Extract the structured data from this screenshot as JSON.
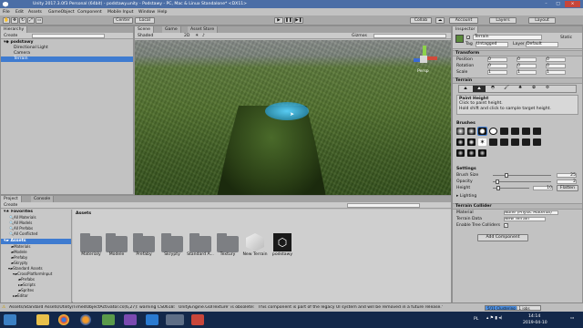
{
  "window": {
    "title": "Unity 2017.3.0f3 Personal (64bit) - podstawy.unity - Podstawy - PC, Mac & Linux Standalone* <DX11>"
  },
  "menu": [
    "File",
    "Edit",
    "Assets",
    "GameObject",
    "Component",
    "Mobile Input",
    "Window",
    "Help"
  ],
  "toolbar": {
    "center_label": "Center",
    "local_label": "Local",
    "collab_label": "Collab",
    "account_label": "Account",
    "layers_label": "Layers",
    "layout_label": "Layout"
  },
  "hierarchy": {
    "tab": "Hierarchy",
    "create_label": "Create",
    "search_placeholder": "All",
    "scene_name": "podstawy",
    "items": [
      "Directional Light",
      "Camera",
      "Terrain"
    ]
  },
  "scene_view": {
    "tabs": [
      "Scene",
      "Game",
      "Asset Store"
    ],
    "shading_label": "Shaded",
    "mode_2d": "2D",
    "gizmos_label": "Gizmos",
    "search_placeholder": "All",
    "persp_label": "Persp"
  },
  "inspector": {
    "tab": "Inspector",
    "object_name": "Terrain",
    "static_label": "Static",
    "tag_label": "Tag",
    "tag_value": "Untagged",
    "layer_label": "Layer",
    "layer_value": "Default",
    "transform": {
      "title": "Transform",
      "rows": [
        {
          "label": "Position",
          "x": "0",
          "y": "0",
          "z": "0"
        },
        {
          "label": "Rotation",
          "x": "0",
          "y": "0",
          "z": "0"
        },
        {
          "label": "Scale",
          "x": "1",
          "y": "1",
          "z": "1"
        }
      ]
    },
    "terrain": {
      "title": "Terrain",
      "tool_title": "Paint Height",
      "tool_desc1": "Click to paint height.",
      "tool_desc2": "Hold shift and click to sample target height.",
      "brushes_label": "Brushes",
      "settings_label": "Settings",
      "brush_size_label": "Brush Size",
      "brush_size_value": "25",
      "brush_size_level": 0.2,
      "opacity_label": "Opacity",
      "opacity_value": "2",
      "opacity_level": 0.05,
      "height_label": "Height",
      "height_value": "10",
      "height_level": 0.1,
      "flatten_label": "Flatten",
      "lighting_label": "Lighting"
    },
    "collider": {
      "title": "Terrain Collider",
      "material_label": "Material",
      "material_value": "None (Physic Material)",
      "data_label": "Terrain Data",
      "data_value": "New Terrain",
      "trees_label": "Enable Tree Colliders"
    },
    "add_component_label": "Add Component"
  },
  "project": {
    "tabs": [
      "Project",
      "Console"
    ],
    "create_label": "Create",
    "favorites_label": "Favorites",
    "favorites": [
      "All Materials",
      "All Models",
      "All Prefabs",
      "All Conflicted"
    ],
    "assets_label": "Assets",
    "tree": [
      "Materials",
      "Modele",
      "Prefaby",
      "Skrypty",
      "Standard Assets",
      "CrossPlatformInput",
      "Prefabs",
      "Scripts",
      "Sprites",
      "Editor",
      "Textury"
    ],
    "breadcrumb": "Assets",
    "assets": [
      "Materialy",
      "Modele",
      "Prefaby",
      "Skrypty",
      "Standard A...",
      "Textury",
      "New Terrain",
      "podstawy"
    ]
  },
  "statusbar": {
    "message": "Assets/Standard Assets/Utility/TimedObjectActivator.cs(6,27): warning CS0618: `UnityEngine.GUITexture' is obsolete: `This component is part of the legacy UI system and will be removed in a future release.'",
    "global_illum": "5/11 Clustering | 1 jobs"
  },
  "taskbar": {
    "lang": "PL",
    "time": "14:14",
    "date": "2019-04-10"
  },
  "colors": {
    "title_blue": "#4b6ea6",
    "selection_blue": "#3e7bd0",
    "panel_grey": "#c2c2c2",
    "taskbar": "#13284a"
  }
}
